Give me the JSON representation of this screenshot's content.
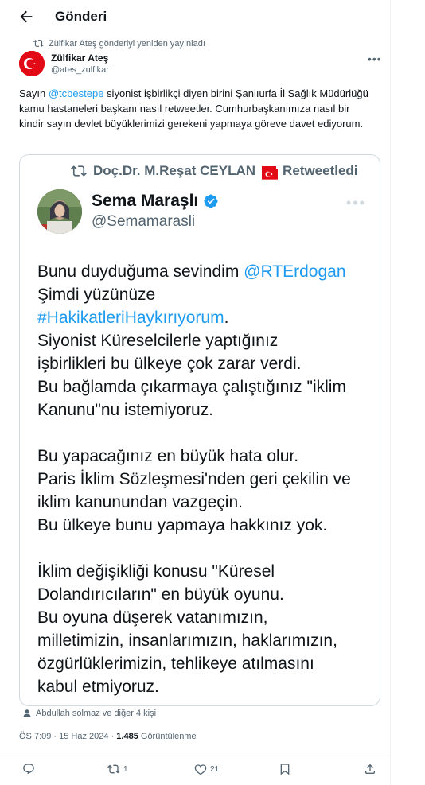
{
  "header": {
    "title": "Gönderi"
  },
  "repost": {
    "text": "Zülfikar Ateş gönderiyi yeniden yayınladı"
  },
  "author": {
    "name": "Zülfikar Ateş",
    "handle": "@ates_zulfikar"
  },
  "post": {
    "text_pre": "Sayın ",
    "mention": "@tcbestepe",
    "text_post": " siyonist işbirlikçi diyen birini Şanlıurfa İl Sağlık Müdürlüğü kamu hastaneleri başkanı nasıl retweetler. Cumhurbaşkanımıza nasıl bir kindir sayın devlet büyüklerimizi gerekeni yapmaya göreve davet ediyorum."
  },
  "card": {
    "retweeted_by": "Doç.Dr. M.Reşat CEYLAN",
    "retweeted_label": "Retweetledi",
    "name": "Sema Maraşlı",
    "handle": "@Semamarasli",
    "l1_text": "Bunu duyduğuma sevindim ",
    "l1_mention": "@RTErdogan",
    "l2": "Şimdi yüzünüze",
    "l3_hashtag": "#HakikatleriHaykırıyorum",
    "l3_dot": ".",
    "l4": "Siyonist Küreselcilerle yaptığınız",
    "l5": "işbirlikleri bu ülkeye çok zarar verdi.",
    "l6": "Bu bağlamda çıkarmaya çalıştığınız \"iklim",
    "l7": "Kanunu\"nu istemiyoruz.",
    "l8": "Bu yapacağınız en büyük hata olur.",
    "l9": "Paris İklim Sözleşmesi'nden geri çekilin ve",
    "l10": "iklim kanunundan vazgeçin.",
    "l11": "Bu ülkeye bunu yapmaya hakkınız yok.",
    "l12": "İklim değişikliği konusu \"Küresel",
    "l13": "Dolandırıcıların\" en büyük oyunu.",
    "l14": "Bu oyuna düşerek vatanımızın,",
    "l15": "milletimizin, insanlarımızın, haklarımızın,",
    "l16": "özgürlüklerimizin, tehlikeye atılmasını",
    "l17": "kabul etmiyoruz."
  },
  "liked_by": "Abdullah solmaz ve diğer 4 kişi",
  "meta": {
    "time": "ÖS 7:09 · 15 Haz 2024 · ",
    "views": "1.485",
    "views_label": " Görüntülenme"
  },
  "actions": {
    "reposts": "1",
    "likes": "21"
  },
  "colors": {
    "link": "#1d9bf0",
    "muted": "#536471",
    "flag_red": "#e30a17"
  }
}
